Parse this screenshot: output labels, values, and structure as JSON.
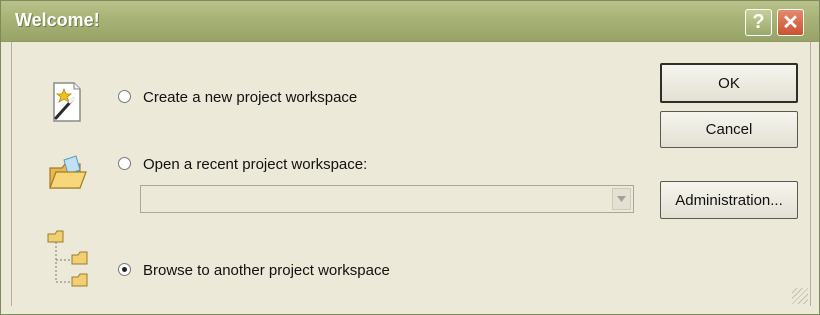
{
  "window": {
    "title": "Welcome!",
    "help_icon": "help-icon",
    "close_icon": "close-icon"
  },
  "options": [
    {
      "label": "Create a new project workspace",
      "icon": "wizard-icon",
      "selected": false
    },
    {
      "label": "Open a recent project workspace:",
      "icon": "open-folder-icon",
      "selected": false
    },
    {
      "label": "Browse to another project workspace",
      "icon": "folder-tree-icon",
      "selected": true
    }
  ],
  "recent_dropdown": {
    "value": "",
    "arrow_icon": "chevron-down-icon"
  },
  "buttons": {
    "ok": "OK",
    "cancel": "Cancel",
    "administration": "Administration..."
  },
  "colors": {
    "titlebar": "#a6b276",
    "dialog_background": "#ece9d8",
    "close_button": "#c9532f"
  }
}
